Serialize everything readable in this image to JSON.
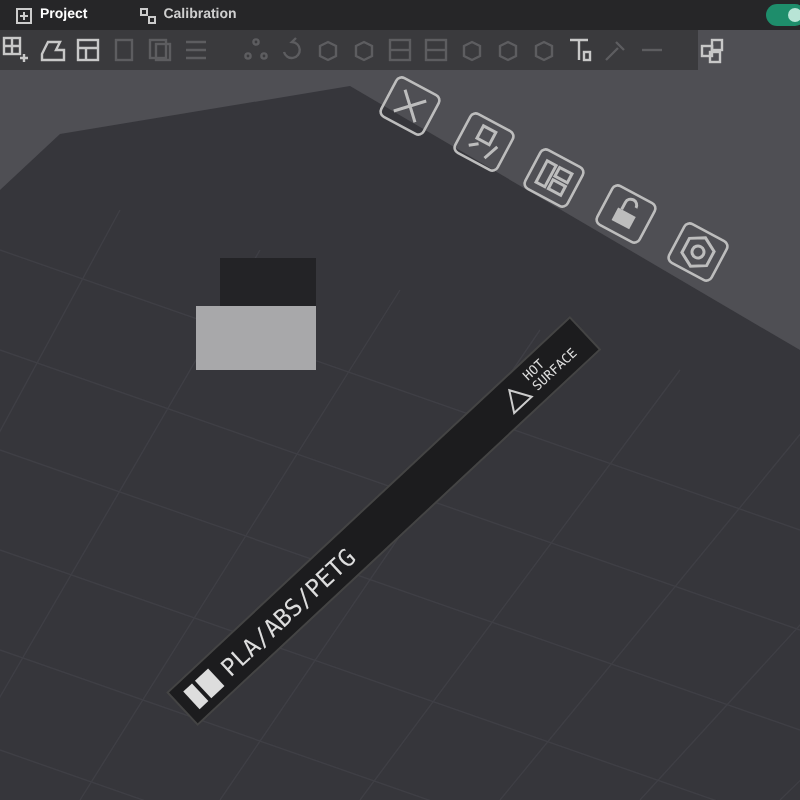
{
  "tabs": [
    {
      "label": "Project",
      "selected": true
    },
    {
      "label": "Calibration",
      "selected": false
    }
  ],
  "toggle": {
    "on": true
  },
  "toolbar": {
    "groups": [
      [
        {
          "disabled": false
        },
        {
          "disabled": false
        },
        {
          "disabled": false
        },
        {
          "disabled": true
        },
        {
          "disabled": true
        },
        {
          "disabled": true
        }
      ],
      [
        {
          "disabled": true
        },
        {
          "disabled": true
        },
        {
          "disabled": true
        },
        {
          "disabled": true
        },
        {
          "disabled": true
        },
        {
          "disabled": true
        },
        {
          "disabled": true
        },
        {
          "disabled": true
        },
        {
          "disabled": true
        },
        {
          "disabled": false
        },
        {
          "disabled": true
        },
        {
          "disabled": true
        }
      ],
      [
        {
          "disabled": false
        }
      ]
    ]
  },
  "plate": {
    "material_label": "PLA/ABS/PETG",
    "warning_lines": [
      "HOT",
      "SURFACE"
    ]
  }
}
